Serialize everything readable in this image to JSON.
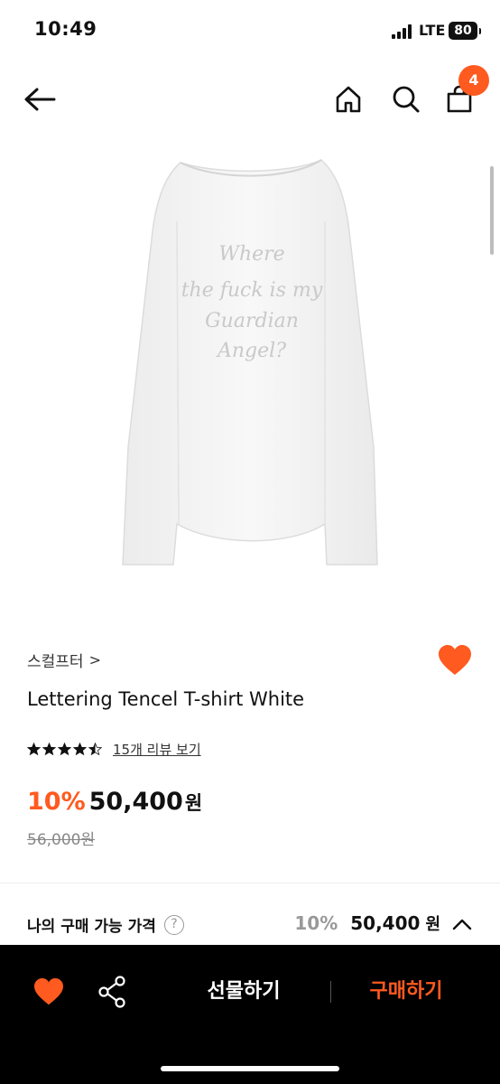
{
  "status_bar": {
    "time": "10:49",
    "network": "LTE",
    "battery": "80"
  },
  "header": {
    "back_icon": "arrow-left-icon",
    "home_icon": "home-icon",
    "search_icon": "search-icon",
    "cart_icon": "shopping-bag-icon",
    "cart_badge": "4"
  },
  "product": {
    "image_print_text": "Where the fuck is my Guardian Angel?",
    "brand": "스컬프터",
    "brand_chevron": ">",
    "title": "Lettering Tencel T-shirt White",
    "rating": 4.5,
    "rating_max": 5,
    "review_link": "15개 리뷰 보기",
    "discount": "10%",
    "price": "50,400",
    "currency": "원",
    "original_price": "56,000원"
  },
  "my_purchase": {
    "label": "나의 구매 가능 가격",
    "help_icon_text": "?",
    "discount": "10%",
    "price": "50,400",
    "currency": "원"
  },
  "bottom_bar": {
    "gift_label": "선물하기",
    "buy_label": "구매하기"
  },
  "colors": {
    "accent": "#ff5a1f",
    "bottom_bar": "#000000",
    "muted": "#999999"
  }
}
